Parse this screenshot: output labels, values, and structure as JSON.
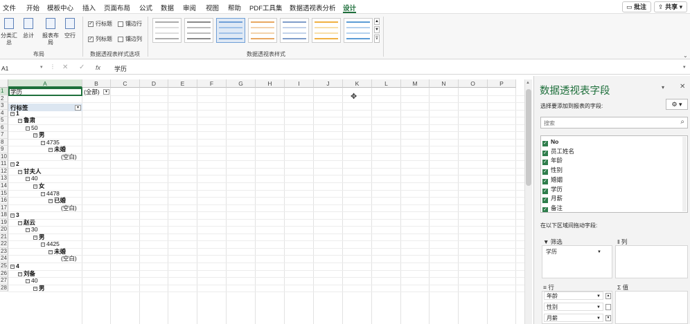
{
  "menu": {
    "tabs": [
      "文件",
      "开始",
      "模板中心",
      "插入",
      "页面布局",
      "公式",
      "数据",
      "审阅",
      "视图",
      "帮助",
      "PDF工具集",
      "数据透视表分析",
      "设计"
    ],
    "active_tab": "设计",
    "comment_label": "批注",
    "share_label": "共享"
  },
  "ribbon": {
    "layout_buttons": [
      "分类汇总",
      "总计",
      "报表布局",
      "空行"
    ],
    "layout_group_label": "布局",
    "style_options": {
      "row_headers": "行标题",
      "banded_rows": "镶边行",
      "col_headers": "列标题",
      "banded_cols": "镶边列",
      "group_label": "数据透视表样式选项"
    },
    "styles_group_label": "数据透视表样式"
  },
  "formula_bar": {
    "name_box": "A1",
    "fx": "fx",
    "content": "学历"
  },
  "sheet": {
    "columns": [
      "A",
      "B",
      "C",
      "D",
      "E",
      "F",
      "G",
      "H",
      "I",
      "J",
      "K",
      "L",
      "M",
      "N",
      "O",
      "P"
    ],
    "rows": [
      "1",
      "2",
      "3",
      "4",
      "5",
      "6",
      "7",
      "8",
      "9",
      "10",
      "11",
      "12",
      "13",
      "14",
      "15",
      "16",
      "17",
      "18",
      "19",
      "20",
      "21",
      "22",
      "23",
      "24",
      "25",
      "26",
      "27",
      "28"
    ],
    "a1": "学历",
    "b1": "(全部)",
    "a3": "行标签",
    "tree": [
      {
        "row": 4,
        "level": 0,
        "text": "1",
        "bold": true,
        "minus": true
      },
      {
        "row": 5,
        "level": 1,
        "text": "鲁肃",
        "bold": true,
        "minus": true
      },
      {
        "row": 6,
        "level": 2,
        "text": "50",
        "bold": false,
        "minus": true
      },
      {
        "row": 7,
        "level": 3,
        "text": "男",
        "bold": true,
        "minus": true
      },
      {
        "row": 8,
        "level": 4,
        "text": "4735",
        "bold": false,
        "minus": true
      },
      {
        "row": 9,
        "level": 5,
        "text": "未婚",
        "bold": true,
        "minus": true
      },
      {
        "row": 10,
        "level": 6,
        "text": "(空白)",
        "bold": false,
        "minus": false
      },
      {
        "row": 11,
        "level": 0,
        "text": "2",
        "bold": true,
        "minus": true
      },
      {
        "row": 12,
        "level": 1,
        "text": "甘夫人",
        "bold": true,
        "minus": true
      },
      {
        "row": 13,
        "level": 2,
        "text": "40",
        "bold": false,
        "minus": true
      },
      {
        "row": 14,
        "level": 3,
        "text": "女",
        "bold": true,
        "minus": true
      },
      {
        "row": 15,
        "level": 4,
        "text": "4478",
        "bold": false,
        "minus": true
      },
      {
        "row": 16,
        "level": 5,
        "text": "已婚",
        "bold": true,
        "minus": true
      },
      {
        "row": 17,
        "level": 6,
        "text": "(空白)",
        "bold": false,
        "minus": false
      },
      {
        "row": 18,
        "level": 0,
        "text": "3",
        "bold": true,
        "minus": true
      },
      {
        "row": 19,
        "level": 1,
        "text": "赵云",
        "bold": true,
        "minus": true
      },
      {
        "row": 20,
        "level": 2,
        "text": "30",
        "bold": false,
        "minus": true
      },
      {
        "row": 21,
        "level": 3,
        "text": "男",
        "bold": true,
        "minus": true
      },
      {
        "row": 22,
        "level": 4,
        "text": "4425",
        "bold": false,
        "minus": true
      },
      {
        "row": 23,
        "level": 5,
        "text": "未婚",
        "bold": true,
        "minus": true
      },
      {
        "row": 24,
        "level": 6,
        "text": "(空白)",
        "bold": false,
        "minus": false
      },
      {
        "row": 25,
        "level": 0,
        "text": "4",
        "bold": true,
        "minus": true
      },
      {
        "row": 26,
        "level": 1,
        "text": "刘备",
        "bold": true,
        "minus": true
      },
      {
        "row": 27,
        "level": 2,
        "text": "40",
        "bold": false,
        "minus": true
      },
      {
        "row": 28,
        "level": 3,
        "text": "男",
        "bold": true,
        "minus": true
      }
    ]
  },
  "pivot_panel": {
    "title": "数据透视表字段",
    "subtitle": "选择要添加到报表的字段:",
    "search_placeholder": "搜索",
    "fields": [
      "No",
      "员工姓名",
      "年龄",
      "性别",
      "婚姻",
      "学历",
      "月薪",
      "备注"
    ],
    "drag_hint": "在以下区域间拖动字段:",
    "filter_label": "筛选",
    "columns_label": "列",
    "rows_label": "行",
    "values_label": "值",
    "filter_items": [
      "学历"
    ],
    "row_items": [
      "年龄",
      "性别",
      "月薪"
    ]
  }
}
